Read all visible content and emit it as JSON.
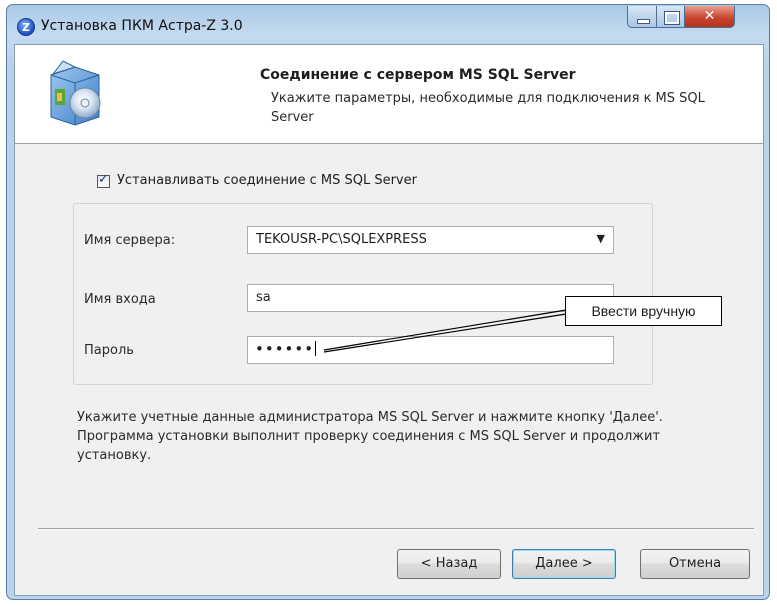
{
  "window": {
    "title": "Установка ПКМ Астра-Z 3.0",
    "icon": "app-z-icon",
    "app_icon_glyph": "Z",
    "close_glyph": "✕"
  },
  "header": {
    "title": "Соединение с сервером MS SQL Server",
    "description": "Укажите параметры, необходимые для подключения к MS SQL Server",
    "icon": "setup-box-cd-icon"
  },
  "connect_checkbox": {
    "label": "Устанавливать соединение с MS SQL Server",
    "checked": true,
    "check_glyph": "✓"
  },
  "form": {
    "server_label": "Имя сервера:",
    "server_value": "TEKOUSR-PC\\SQLEXPRESS",
    "server_arrow": "▼",
    "login_label": "Имя входа",
    "login_value": "sa",
    "password_label": "Пароль",
    "password_value": "••••••"
  },
  "callout": {
    "text": "Ввести вручную"
  },
  "info_text": "Укажите учетные данные администратора MS SQL Server и нажмите кнопку 'Далее'. Программа установки выполнит проверку соединения с MS SQL Server и продолжит установку.",
  "buttons": {
    "back": "< Назад",
    "next": "Далее >",
    "cancel": "Отмена"
  },
  "colors": {
    "title_bar": "#b8d2ea",
    "client": "#f0f0f0",
    "close_button": "#c8462f"
  }
}
